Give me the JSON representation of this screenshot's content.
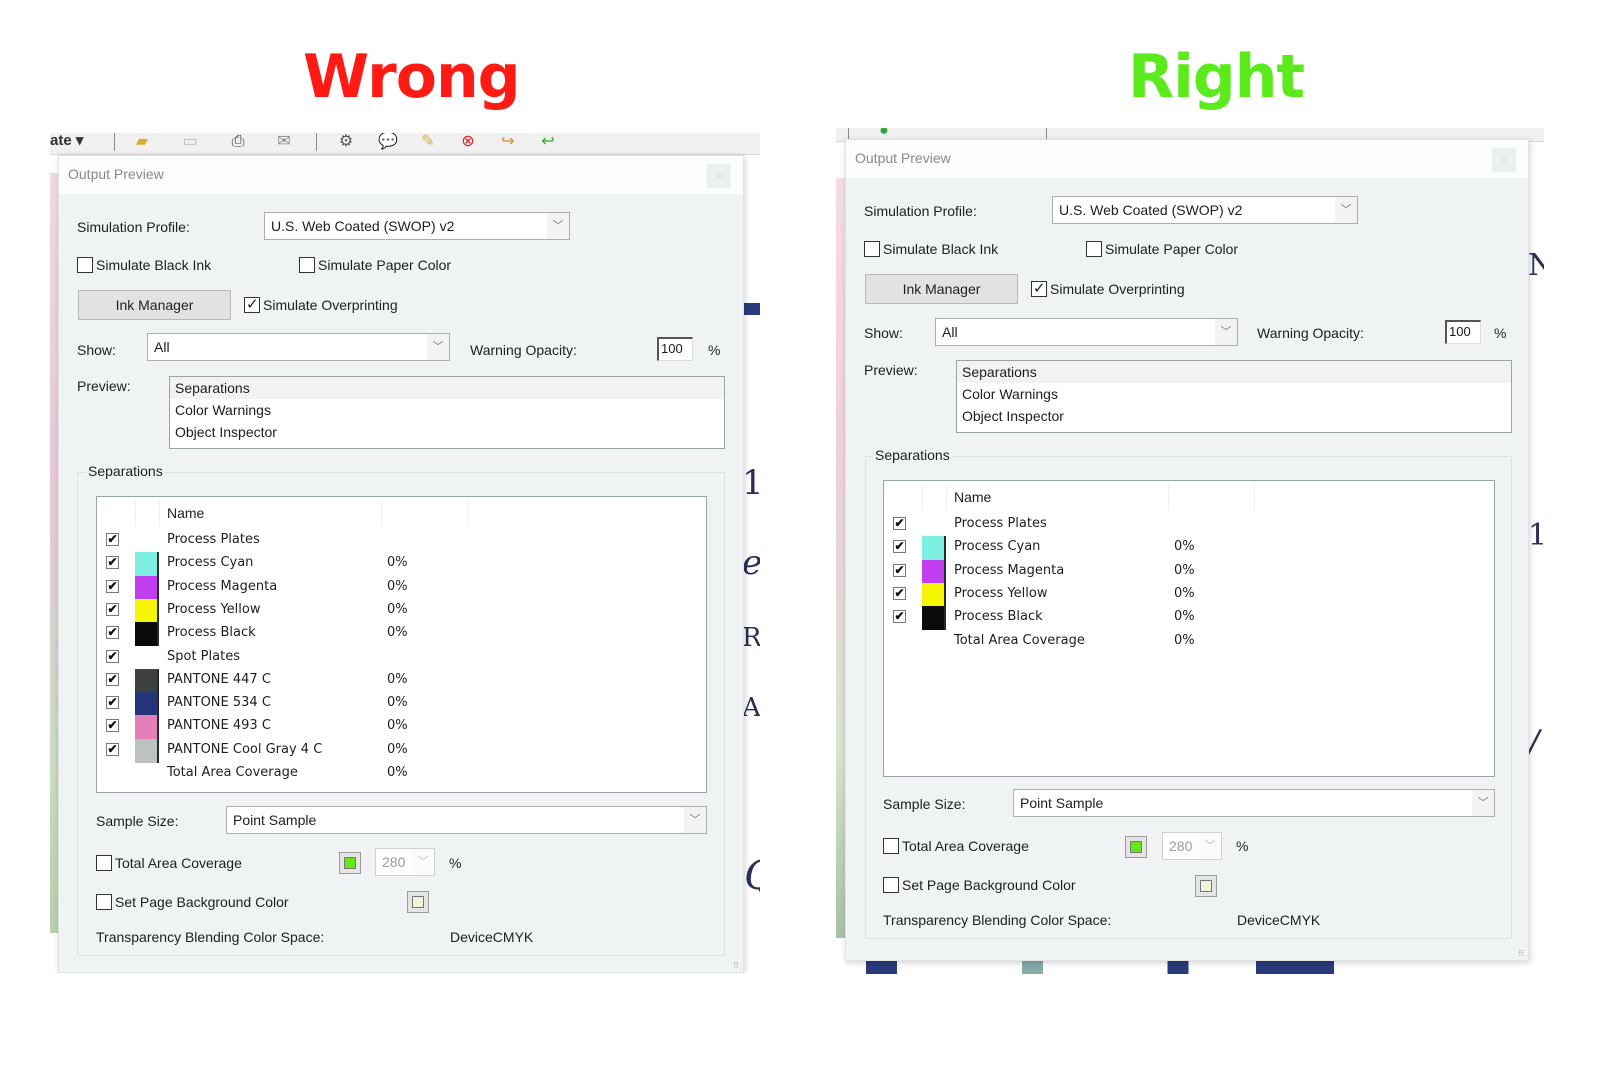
{
  "headings": {
    "wrong": "Wrong",
    "right": "Right"
  },
  "colors": {
    "wrong": "#ff1a14",
    "right": "#5bea1c"
  },
  "left_toolbar": {
    "menu_label": "ate ▾"
  },
  "dialogs": {
    "wrong": {
      "title": "Output Preview",
      "close_icon": "×",
      "simulation_profile_label": "Simulation Profile:",
      "simulation_profile_value": "U.S. Web Coated (SWOP) v2",
      "simulate_black_ink": {
        "label": "Simulate Black Ink",
        "checked": false
      },
      "simulate_paper_color": {
        "label": "Simulate Paper Color",
        "checked": false
      },
      "ink_manager_label": "Ink Manager",
      "simulate_overprinting": {
        "label": "Simulate Overprinting",
        "checked": true
      },
      "show_label": "Show:",
      "show_value": "All",
      "warning_opacity_label": "Warning Opacity:",
      "warning_opacity_value": "100",
      "percent": "%",
      "preview_label": "Preview:",
      "preview_items": [
        "Separations",
        "Color Warnings",
        "Object Inspector"
      ],
      "separations_group": "Separations",
      "table_header_name": "Name",
      "rows": [
        {
          "name": "Process Plates",
          "checked": true,
          "swatch": "",
          "pct": ""
        },
        {
          "name": "Process Cyan",
          "checked": true,
          "swatch": "#7ef0e2",
          "pct": "0%"
        },
        {
          "name": "Process Magenta",
          "checked": true,
          "swatch": "#c03ef0",
          "pct": "0%"
        },
        {
          "name": "Process Yellow",
          "checked": true,
          "swatch": "#f6f600",
          "pct": "0%"
        },
        {
          "name": "Process Black",
          "checked": true,
          "swatch": "#0b0b0b",
          "pct": "0%"
        },
        {
          "name": "Spot Plates",
          "checked": true,
          "swatch": "",
          "pct": ""
        },
        {
          "name": "PANTONE 447 C",
          "checked": true,
          "swatch": "#3c403e",
          "pct": "0%"
        },
        {
          "name": "PANTONE 534 C",
          "checked": true,
          "swatch": "#24357a",
          "pct": "0%"
        },
        {
          "name": "PANTONE 493 C",
          "checked": true,
          "swatch": "#e57fb8",
          "pct": "0%"
        },
        {
          "name": "PANTONE Cool Gray 4 C",
          "checked": true,
          "swatch": "#bcc1c1",
          "pct": "0%"
        },
        {
          "name": "Total Area Coverage",
          "checked": null,
          "swatch": "",
          "pct": "0%"
        }
      ],
      "sample_size_label": "Sample Size:",
      "sample_size_value": "Point Sample",
      "total_area_coverage": {
        "label": "Total Area Coverage",
        "checked": false,
        "color": "#66e61a",
        "value": "280",
        "unit": "%"
      },
      "set_page_background": {
        "label": "Set Page Background Color",
        "checked": false,
        "color": "#f2f2d8"
      },
      "transparency_label": "Transparency Blending Color Space:",
      "transparency_value": "DeviceCMYK"
    },
    "right": {
      "title": "Output Preview",
      "close_icon": "×",
      "simulation_profile_label": "Simulation Profile:",
      "simulation_profile_value": "U.S. Web Coated (SWOP) v2",
      "simulate_black_ink": {
        "label": "Simulate Black Ink",
        "checked": false
      },
      "simulate_paper_color": {
        "label": "Simulate Paper Color",
        "checked": false
      },
      "ink_manager_label": "Ink Manager",
      "simulate_overprinting": {
        "label": "Simulate Overprinting",
        "checked": true
      },
      "show_label": "Show:",
      "show_value": "All",
      "warning_opacity_label": "Warning Opacity:",
      "warning_opacity_value": "100",
      "percent": "%",
      "preview_label": "Preview:",
      "preview_items": [
        "Separations",
        "Color Warnings",
        "Object Inspector"
      ],
      "separations_group": "Separations",
      "table_header_name": "Name",
      "rows": [
        {
          "name": "Process Plates",
          "checked": true,
          "swatch": "",
          "pct": ""
        },
        {
          "name": "Process Cyan",
          "checked": true,
          "swatch": "#7ef0e2",
          "pct": "0%"
        },
        {
          "name": "Process Magenta",
          "checked": true,
          "swatch": "#c03ef0",
          "pct": "0%"
        },
        {
          "name": "Process Yellow",
          "checked": true,
          "swatch": "#f6f600",
          "pct": "0%"
        },
        {
          "name": "Process Black",
          "checked": true,
          "swatch": "#0b0b0b",
          "pct": "0%"
        },
        {
          "name": "Total Area Coverage",
          "checked": null,
          "swatch": "",
          "pct": "0%"
        }
      ],
      "sample_size_label": "Sample Size:",
      "sample_size_value": "Point Sample",
      "total_area_coverage": {
        "label": "Total Area Coverage",
        "checked": false,
        "color": "#66e61a",
        "value": "280",
        "unit": "%"
      },
      "set_page_background": {
        "label": "Set Page Background Color",
        "checked": false,
        "color": "#f2f2d8"
      },
      "transparency_label": "Transparency Blending Color Space:",
      "transparency_value": "DeviceCMYK"
    }
  }
}
